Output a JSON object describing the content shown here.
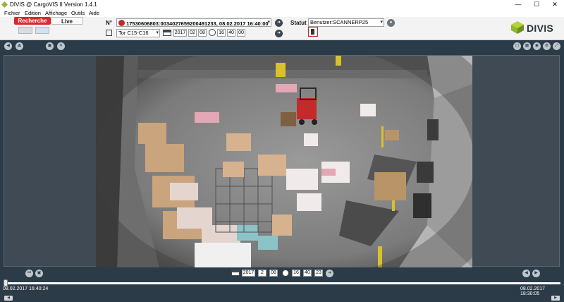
{
  "window": {
    "title": "DIVIS @ CargoVIS II Version 1.4.1",
    "controls": [
      "—",
      "☐",
      "✕"
    ]
  },
  "menu": [
    "Fichier",
    "Edition",
    "Affichage",
    "Outils",
    "Aide"
  ],
  "tabs": {
    "recherche": "Recherche",
    "live": "Live"
  },
  "search": {
    "number_label": "N°",
    "number_value": "17530606803:003402765920049123​3, 08.02.2017 16:40:00",
    "gate_value": "Tor C15-C16",
    "date": {
      "year": "2017",
      "month": "02",
      "day": "08"
    },
    "time": {
      "hour": "16",
      "minute": "40",
      "second": "00"
    },
    "status_label": "Statut",
    "status_value": "Benutzer:SCANNERP25"
  },
  "logo": {
    "text": "DIVIS"
  },
  "playback": {
    "date": {
      "year": "2017",
      "month": "2",
      "day": "08"
    },
    "time": {
      "hour": "16",
      "minute": "40",
      "second": "23"
    },
    "start_time": "08.02.2017 16:40:24",
    "end_time": "08.02.2017 18:30:05",
    "position": 0.0
  },
  "colors": {
    "accent_red": "#e0262a",
    "panel_dark": "#2b3b48",
    "logo_green": "#8fb82c"
  }
}
